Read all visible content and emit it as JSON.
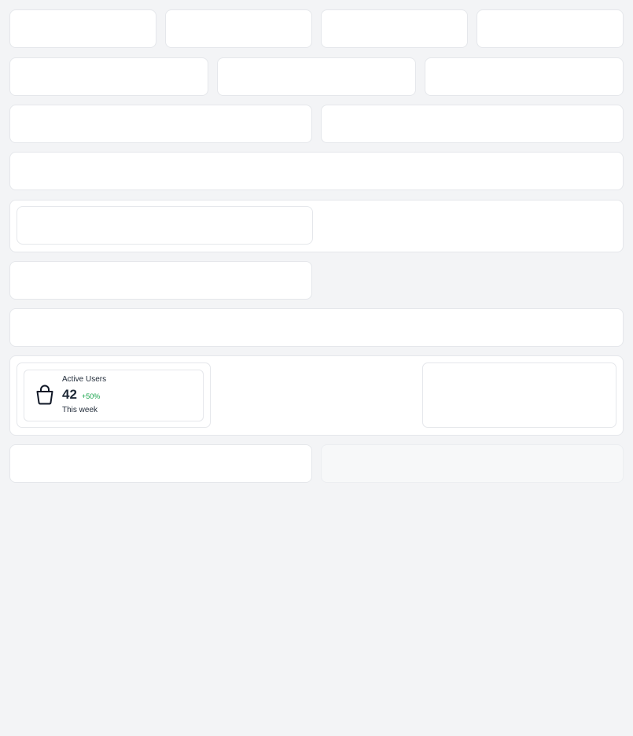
{
  "stat_card": {
    "label": "Active Users",
    "value": "42",
    "change": "+50%",
    "period": "This week",
    "icon": "shopping-bag-icon",
    "change_color": "#16a34a"
  },
  "colors": {
    "background": "#f3f4f6",
    "card": "#ffffff",
    "border": "#e5e7eb"
  }
}
